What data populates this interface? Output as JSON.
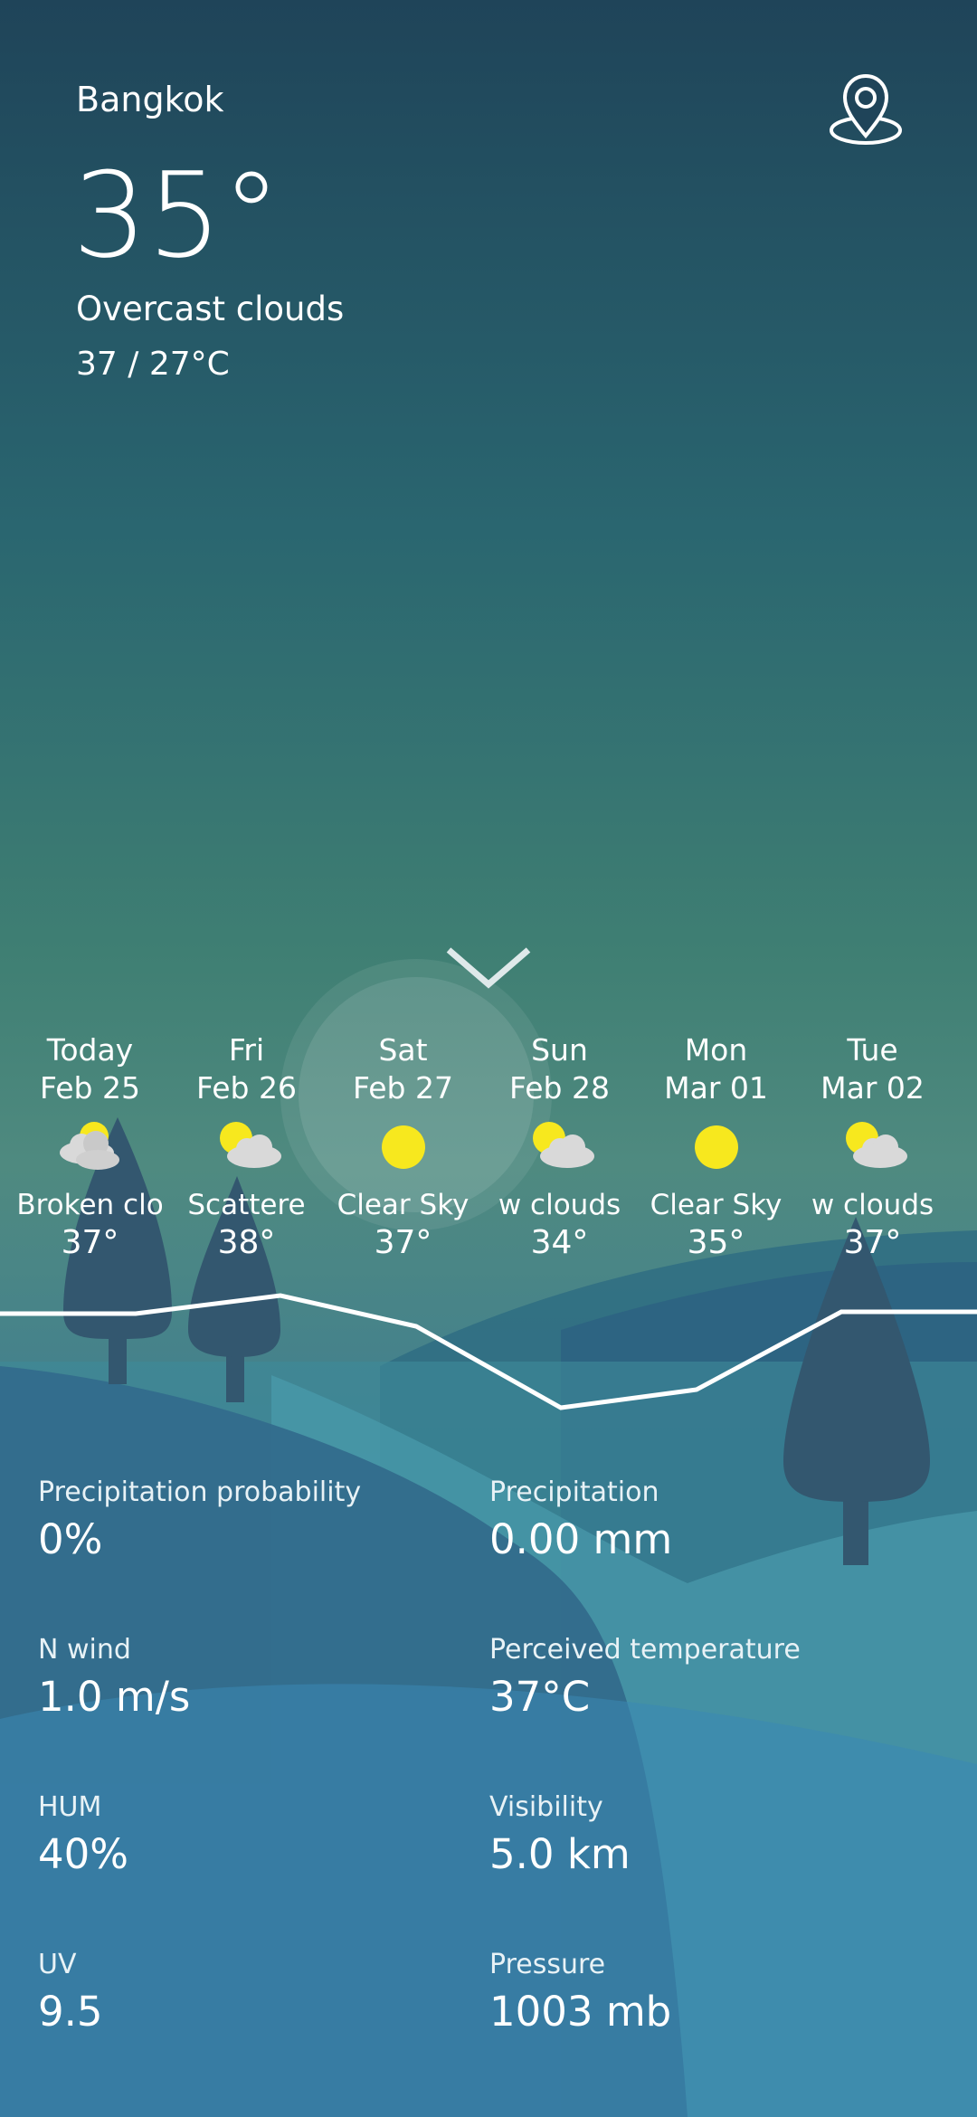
{
  "header": {
    "city": "Bangkok",
    "temperature": "35°",
    "condition": "Overcast clouds",
    "range": "37 / 27°C",
    "location_icon": "map-pin-icon"
  },
  "expand_icon": "chevron-down-icon",
  "forecast": [
    {
      "day": "Today",
      "date": "Feb 25",
      "icon": "broken-clouds-icon",
      "desc": "Broken clo",
      "temp": "37°"
    },
    {
      "day": "Fri",
      "date": "Feb 26",
      "icon": "partly-cloudy-icon",
      "desc": "Scattere",
      "temp": "38°"
    },
    {
      "day": "Sat",
      "date": "Feb 27",
      "icon": "sun-icon",
      "desc": "Clear Sky",
      "temp": "37°"
    },
    {
      "day": "Sun",
      "date": "Feb 28",
      "icon": "partly-cloudy-icon",
      "desc": "w clouds",
      "temp": "34°"
    },
    {
      "day": "Mon",
      "date": "Mar 01",
      "icon": "sun-icon",
      "desc": "Clear Sky",
      "temp": "35°"
    },
    {
      "day": "Tue",
      "date": "Mar 02",
      "icon": "partly-cloudy-icon",
      "desc": "w clouds",
      "temp": "37°"
    }
  ],
  "metrics": [
    {
      "label": "Precipitation probability",
      "value": "0%"
    },
    {
      "label": "Precipitation",
      "value": "0.00 mm"
    },
    {
      "label": "N wind",
      "value": "1.0 m/s"
    },
    {
      "label": "Perceived temperature",
      "value": "37°C"
    },
    {
      "label": "HUM",
      "value": "40%"
    },
    {
      "label": "Visibility",
      "value": "5.0 km"
    },
    {
      "label": "UV",
      "value": "9.5"
    },
    {
      "label": "Pressure",
      "value": "1003 mb"
    }
  ],
  "colors": {
    "sun": "#f7e81e",
    "cloud": "#d9d9d9",
    "tree": "#33576f"
  }
}
